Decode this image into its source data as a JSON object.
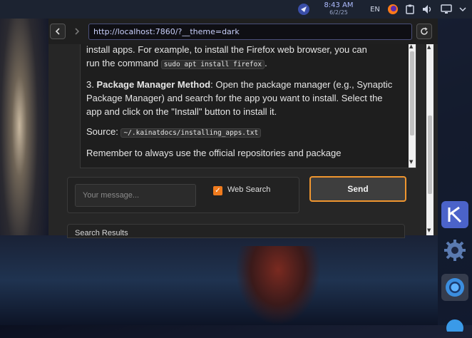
{
  "topbar": {
    "time": "8:43 AM",
    "date": "6/2/25",
    "language": "EN"
  },
  "browser": {
    "url": "http://localhost:7860/?__theme=dark"
  },
  "chat": {
    "line1_prefix": "install apps. For example, to install the Firefox web browser, you can",
    "line2_prefix": "run the command",
    "command": "sudo apt install firefox",
    "method_number": "3.",
    "method_title": "Package Manager Method",
    "method_text": ": Open the package manager (e.g., Synaptic Package Manager) and search for the app you want to install. Select the app and click on the \"Install\" button to install it.",
    "source_label": "Source:",
    "source_path": "~/.kainatdocs/installing_apps.txt",
    "reminder": "Remember to always use the official repositories and package"
  },
  "input": {
    "placeholder": "Your message...",
    "web_search_label": "Web Search",
    "web_search_checked": true
  },
  "send_label": "Send",
  "results_label": "Search Results",
  "colors": {
    "accent": "#f0962f",
    "checkbox": "#f07b1d",
    "url_text": "#c8cffa"
  }
}
